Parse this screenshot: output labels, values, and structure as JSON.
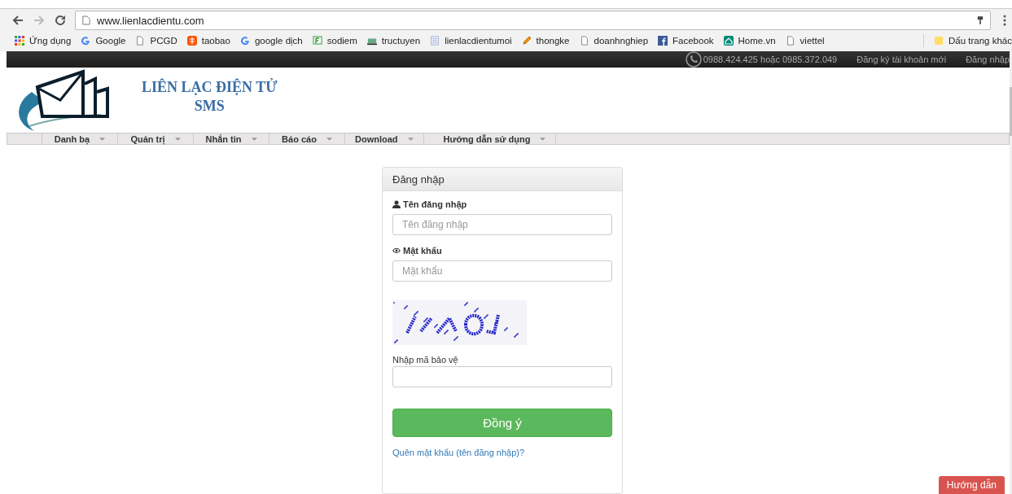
{
  "browser": {
    "url": "www.lienlacdientu.com",
    "bookmarks": [
      "Ứng dụng",
      "Google",
      "PCGD",
      "taobao",
      "google dịch",
      "sodiem",
      "tructuyen",
      "lienlacdientumoi",
      "thongke",
      "doanhnghiep",
      "Facebook",
      "Home.vn",
      "viettel"
    ],
    "other_bookmarks": "Dấu trang khác"
  },
  "topbar": {
    "phone": "0988.424.425 hoặc 0985.372.049",
    "links": [
      "Đăng ký tài khoản mới",
      "Đăng nhập"
    ]
  },
  "brand": {
    "title": "LIÊN LẠC ĐIỆN TỬ",
    "subtitle": "SMS"
  },
  "nav": [
    "Danh bạ",
    "Quản trị",
    "Nhắn tin",
    "Báo cáo",
    "Download",
    "Hướng dẫn sử dụng"
  ],
  "login": {
    "heading": "Đăng nhập",
    "fields": [
      {
        "label": "Tên đăng nhập",
        "placeholder": "Tên đăng nhập"
      },
      {
        "label": "Mật khẩu",
        "placeholder": "Mật khẩu"
      }
    ],
    "captcha_label": "Nhập mã bảo vệ",
    "submit": "Đồng ý",
    "forgot": "Quên mật khẩu (tên đăng nhập)?"
  },
  "help_button": "Hướng dẫn"
}
